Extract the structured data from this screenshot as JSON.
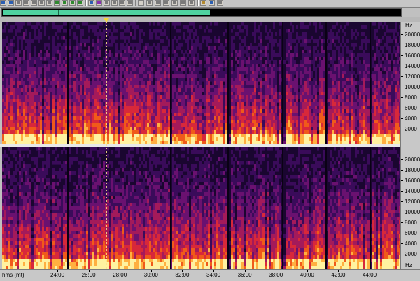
{
  "toolbar": {
    "buttons": [
      {
        "icon": "undo-icon",
        "color": "#2b5fb3"
      },
      {
        "icon": "redo-icon",
        "color": "#2b5fb3"
      },
      {
        "icon": "cut-icon",
        "color": "#7a7a7a"
      },
      {
        "icon": "copy-icon",
        "color": "#7a7a7a"
      },
      {
        "icon": "paste-icon",
        "color": "#7a7a7a"
      },
      {
        "icon": "mix-paste-icon",
        "color": "#7a7a7a"
      },
      {
        "icon": "trim-icon",
        "color": "#7a7a7a"
      },
      {
        "icon": "zoom-in-icon",
        "color": "#2f8a2f"
      },
      {
        "icon": "zoom-out-icon",
        "color": "#2f8a2f"
      },
      {
        "icon": "zoom-full-icon",
        "color": "#2f8a2f"
      },
      {
        "icon": "zoom-selection-icon",
        "color": "#2f8a2f"
      },
      {
        "icon": "marker-icon",
        "color": "#2b5fb3"
      },
      {
        "icon": "spectral-view-icon",
        "color": "#8a2fb3"
      },
      {
        "icon": "waveform-view-icon",
        "color": "#7a7a7a"
      },
      {
        "icon": "mono-icon",
        "color": "#7a7a7a"
      },
      {
        "icon": "left-channel-icon",
        "color": "#7a7a7a"
      },
      {
        "icon": "right-channel-icon",
        "color": "#7a7a7a"
      },
      {
        "icon": "blank-icon",
        "color": "#d4d0c8"
      },
      {
        "icon": "frame-icon",
        "color": "#7a7a7a"
      },
      {
        "icon": "loop-icon",
        "color": "#7a7a7a"
      },
      {
        "icon": "pencil-icon",
        "color": "#7a7a7a"
      },
      {
        "icon": "effects-icon",
        "color": "#7a7a7a"
      },
      {
        "icon": "meter-icon",
        "color": "#7a7a7a"
      },
      {
        "icon": "list-icon",
        "color": "#7a7a7a"
      },
      {
        "icon": "settings-icon",
        "color": "#b38a2f"
      },
      {
        "icon": "help-icon",
        "color": "#2b5fb3"
      },
      {
        "icon": "close-icon",
        "color": "#7a7a7a"
      }
    ]
  },
  "overview": {
    "visible_fraction": 0.52,
    "accent_color": "#4fd1a0"
  },
  "cursor": {
    "time_label": "27:20",
    "color": "#f5d53a"
  },
  "spectrogram": {
    "colormap": [
      "#1a0630",
      "#3a0b5a",
      "#6a1170",
      "#a41a5a",
      "#d8283a",
      "#f05a1a",
      "#ffb040",
      "#fff2a0"
    ],
    "time_range": [
      "22:40",
      "45:20"
    ],
    "freq_range_hz": [
      0,
      22050
    ],
    "channels": [
      "left",
      "right"
    ]
  },
  "freq_ruler": {
    "unit": "Hz",
    "labels": [
      "20000",
      "18000",
      "16000",
      "14000",
      "12000",
      "10000",
      "8000",
      "6000",
      "4000",
      "2000"
    ]
  },
  "time_ruler": {
    "unit_label": "hms (mt)",
    "labels": [
      "24:00",
      "26:00",
      "28:00",
      "30:00",
      "32:00",
      "34:00",
      "36:00",
      "38:00",
      "40:00",
      "42:00",
      "44:00"
    ],
    "end_unit": "Hz"
  }
}
